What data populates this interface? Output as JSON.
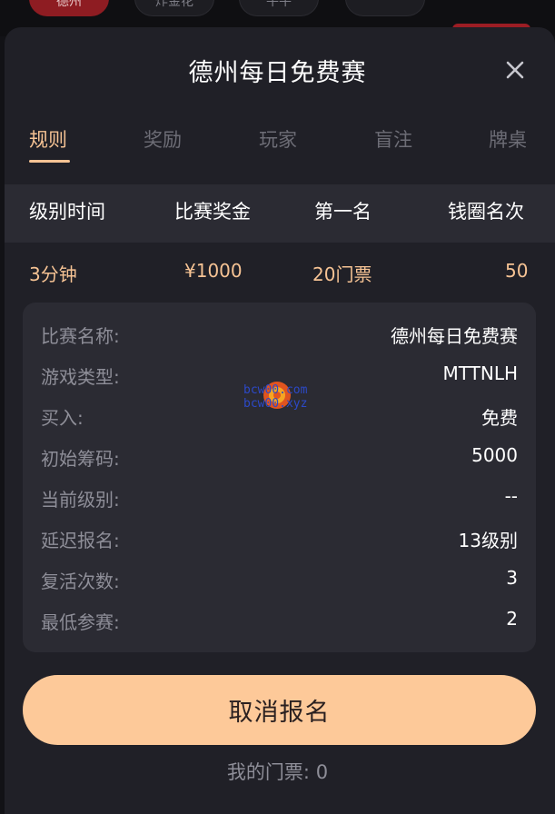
{
  "background": {
    "pills": [
      "德州",
      "炸金花",
      "牛牛",
      ""
    ]
  },
  "modal": {
    "title": "德州每日免费赛",
    "close_icon": "close-icon"
  },
  "tabs": [
    {
      "label": "规则",
      "active": true
    },
    {
      "label": "奖励",
      "active": false
    },
    {
      "label": "玩家",
      "active": false
    },
    {
      "label": "盲注",
      "active": false
    },
    {
      "label": "牌桌",
      "active": false
    }
  ],
  "summary": {
    "headers": [
      "级别时间",
      "比赛奖金",
      "第一名",
      "钱圈名次"
    ],
    "values": [
      "3分钟",
      "¥1000",
      "20门票",
      "50"
    ]
  },
  "details": [
    {
      "label": "比赛名称:",
      "value": "德州每日免费赛"
    },
    {
      "label": "游戏类型:",
      "value": "MTTNLH"
    },
    {
      "label": "买入:",
      "value": "免费"
    },
    {
      "label": "初始筹码:",
      "value": "5000"
    },
    {
      "label": "当前级别:",
      "value": "--"
    },
    {
      "label": "延迟报名:",
      "value": "13级别"
    },
    {
      "label": "复活次数:",
      "value": "3"
    },
    {
      "label": "最低参赛:",
      "value": "2"
    }
  ],
  "watermark": {
    "line1": "bcw00.com",
    "line2": "bcw00.xyz"
  },
  "actions": {
    "cancel_label": "取消报名",
    "tickets_label": "我的门票:",
    "tickets_count": "0"
  },
  "colors": {
    "accent": "#f6c394",
    "button": "#fdc999",
    "sheet": "#202027",
    "card": "#2b2b33"
  }
}
